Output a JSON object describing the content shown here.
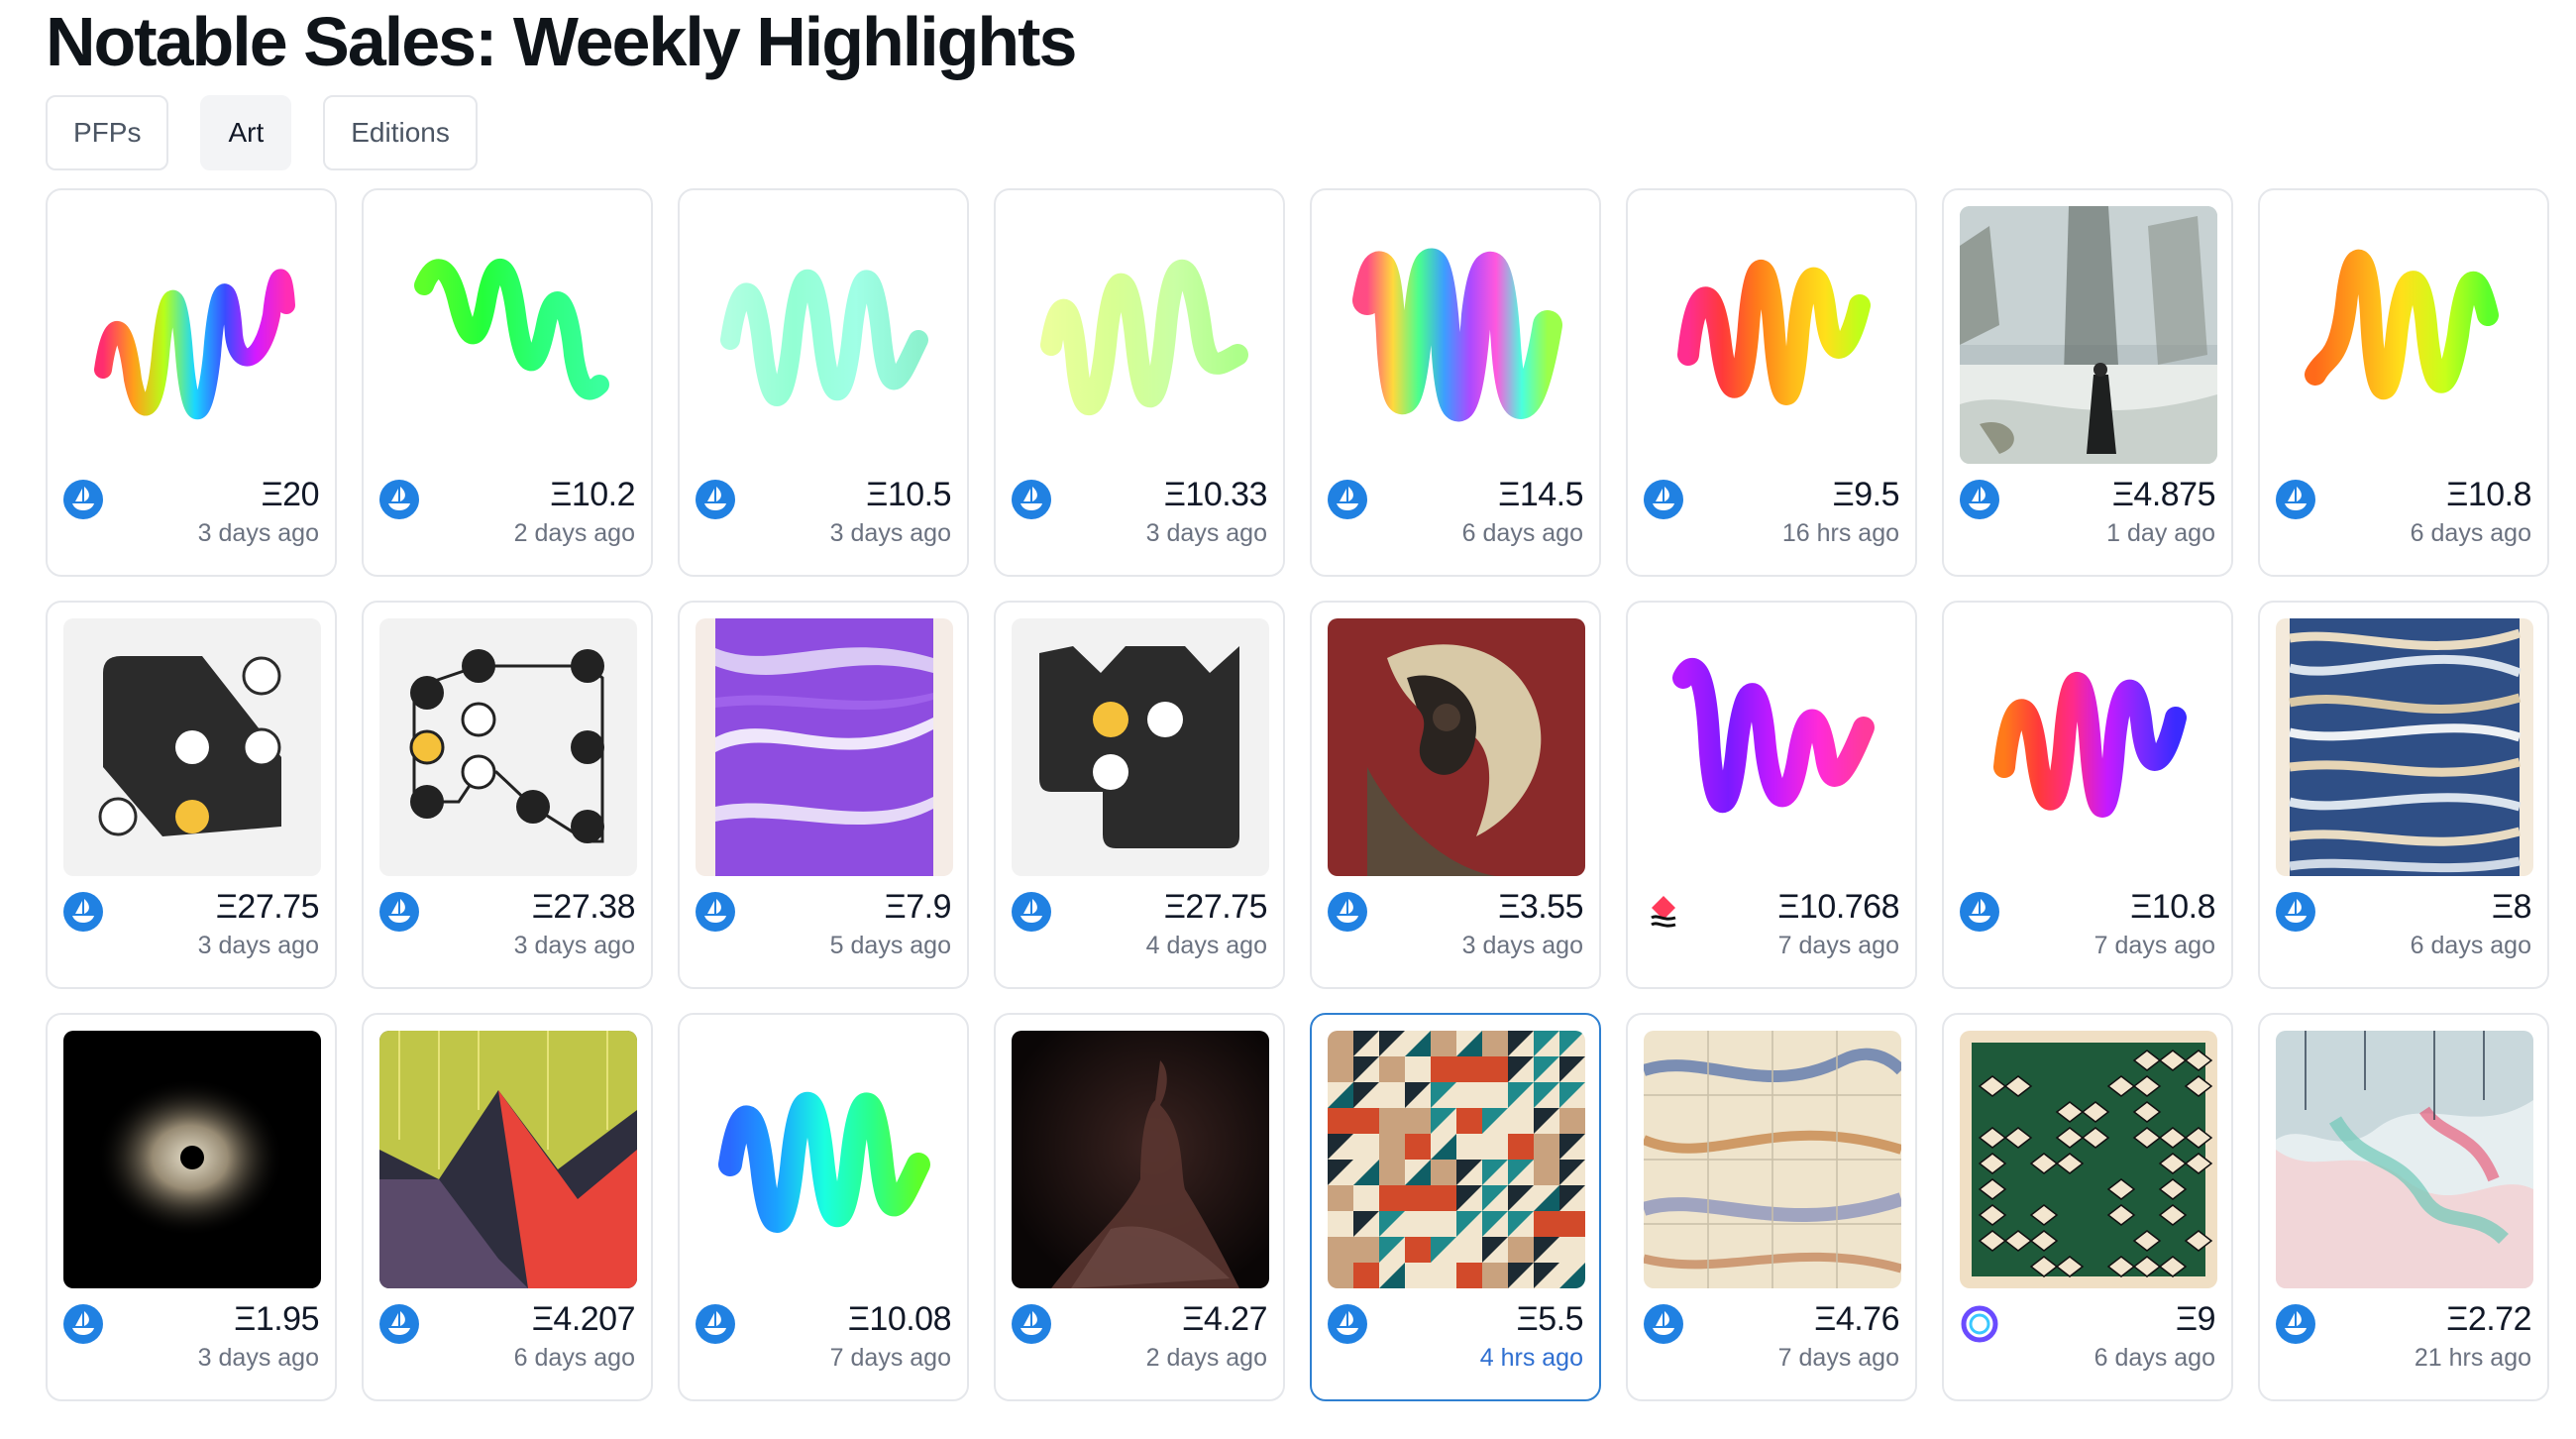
{
  "page": {
    "title": "Notable Sales: Weekly Highlights"
  },
  "tabs": [
    {
      "label": "PFPs",
      "active": false
    },
    {
      "label": "Art",
      "active": true
    },
    {
      "label": "Editions",
      "active": false
    }
  ],
  "colors": {
    "opensea_blue": "#2081e2",
    "selected_border": "#2f80d1",
    "muted_text": "#6b7280"
  },
  "sales": [
    {
      "art": "squiggle-rainbow",
      "market": "opensea-icon",
      "price": "Ξ20",
      "time": "3 days ago"
    },
    {
      "art": "squiggle-green",
      "market": "opensea-icon",
      "price": "Ξ10.2",
      "time": "2 days ago"
    },
    {
      "art": "squiggle-mint-translucent",
      "market": "opensea-icon",
      "price": "Ξ10.5",
      "time": "3 days ago"
    },
    {
      "art": "squiggle-lime-translucent",
      "market": "opensea-icon",
      "price": "Ξ10.33",
      "time": "3 days ago"
    },
    {
      "art": "squiggle-blurred-rainbow",
      "market": "opensea-icon",
      "price": "Ξ14.5",
      "time": "6 days ago"
    },
    {
      "art": "squiggle-warm",
      "market": "opensea-icon",
      "price": "Ξ9.5",
      "time": "16 hrs ago"
    },
    {
      "art": "winter-painting",
      "market": "opensea-icon",
      "price": "Ξ4.875",
      "time": "1 day ago"
    },
    {
      "art": "squiggle-orange-green",
      "market": "opensea-icon",
      "price": "Ξ10.8",
      "time": "6 days ago"
    },
    {
      "art": "dark-shape-dots",
      "market": "opensea-icon",
      "price": "Ξ27.75",
      "time": "3 days ago"
    },
    {
      "art": "node-graph",
      "market": "opensea-icon",
      "price": "Ξ27.38",
      "time": "3 days ago"
    },
    {
      "art": "purple-marble",
      "market": "opensea-icon",
      "price": "Ξ7.9",
      "time": "5 days ago"
    },
    {
      "art": "dark-block-dots",
      "market": "opensea-icon",
      "price": "Ξ27.75",
      "time": "4 days ago"
    },
    {
      "art": "red-collage",
      "market": "opensea-icon",
      "price": "Ξ3.55",
      "time": "3 days ago"
    },
    {
      "art": "squiggle-purple-pink",
      "market": "foundation-icon",
      "price": "Ξ10.768",
      "time": "7 days ago"
    },
    {
      "art": "squiggle-orange-blue",
      "market": "opensea-icon",
      "price": "Ξ10.8",
      "time": "7 days ago"
    },
    {
      "art": "blue-strata",
      "market": "opensea-icon",
      "price": "Ξ8",
      "time": "6 days ago"
    },
    {
      "art": "black-hole",
      "market": "opensea-icon",
      "price": "Ξ1.95",
      "time": "3 days ago"
    },
    {
      "art": "neon-landscape",
      "market": "opensea-icon",
      "price": "Ξ4.207",
      "time": "6 days ago"
    },
    {
      "art": "squiggle-blue-green",
      "market": "opensea-icon",
      "price": "Ξ10.08",
      "time": "7 days ago"
    },
    {
      "art": "dark-figure",
      "market": "opensea-icon",
      "price": "Ξ4.27",
      "time": "2 days ago"
    },
    {
      "art": "geometric-pattern",
      "market": "opensea-icon",
      "price": "Ξ5.5",
      "time": "4 hrs ago",
      "selected": true
    },
    {
      "art": "marbled-tiles",
      "market": "opensea-icon",
      "price": "Ξ4.76",
      "time": "7 days ago"
    },
    {
      "art": "green-isometric",
      "market": "ring-icon",
      "price": "Ξ9",
      "time": "6 days ago"
    },
    {
      "art": "pastel-drips",
      "market": "opensea-icon",
      "price": "Ξ2.72",
      "time": "21 hrs ago"
    }
  ]
}
